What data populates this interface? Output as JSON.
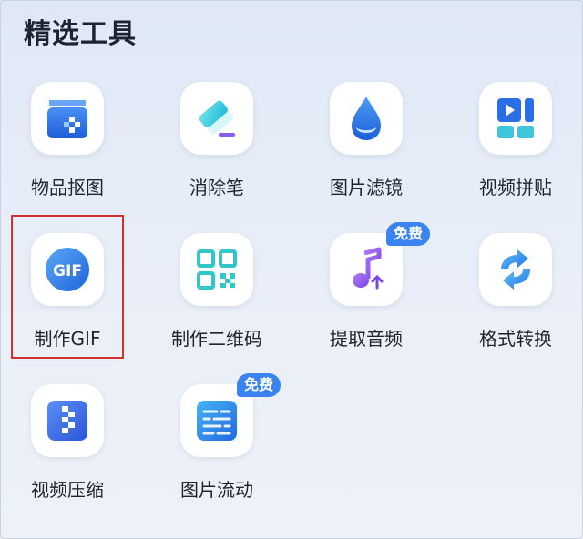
{
  "section": {
    "title": "精选工具"
  },
  "tools": [
    {
      "label": "物品抠图",
      "icon": "cutout-box-icon"
    },
    {
      "label": "消除笔",
      "icon": "eraser-icon"
    },
    {
      "label": "图片滤镜",
      "icon": "water-drop-icon"
    },
    {
      "label": "视频拼贴",
      "icon": "video-collage-icon"
    },
    {
      "label": "制作GIF",
      "icon": "gif-icon",
      "icon_text": "GIF",
      "selected": true
    },
    {
      "label": "制作二维码",
      "icon": "qr-code-icon"
    },
    {
      "label": "提取音频",
      "icon": "music-note-icon",
      "badge": "免费"
    },
    {
      "label": "格式转换",
      "icon": "convert-arrows-icon"
    },
    {
      "label": "视频压缩",
      "icon": "video-compress-icon"
    },
    {
      "label": "图片流动",
      "icon": "image-flow-icon",
      "badge": "免费"
    }
  ],
  "colors": {
    "accent": "#3c83f2",
    "highlight_border": "#d03232",
    "background": "#e5ecf7"
  }
}
